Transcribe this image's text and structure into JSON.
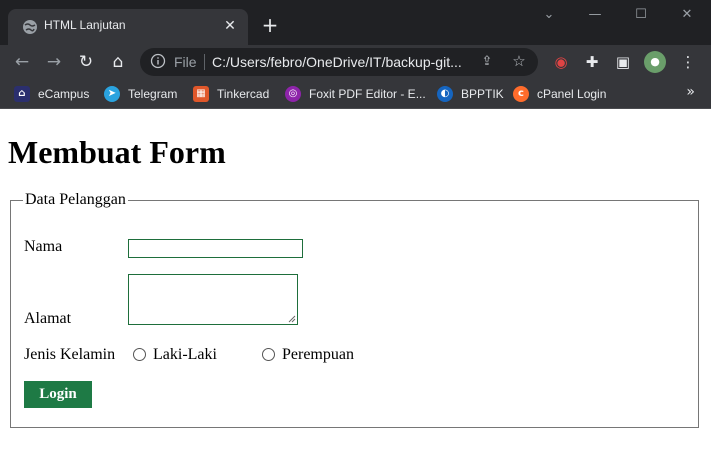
{
  "browser": {
    "tab_title": "HTML Lanjutan",
    "omnibox_scheme": "File",
    "url": "C:/Users/febro/OneDrive/IT/backup-git...",
    "bookmarks": [
      {
        "label": "eCampus"
      },
      {
        "label": "Telegram"
      },
      {
        "label": "Tinkercad"
      },
      {
        "label": "Foxit PDF Editor - E..."
      },
      {
        "label": "BPPTIK"
      },
      {
        "label": "cPanel Login"
      }
    ],
    "more_glyph": "»"
  },
  "page": {
    "heading": "Membuat Form",
    "fieldset_legend": "Data Pelanggan",
    "labels": {
      "nama": "Nama",
      "alamat": "Alamat",
      "jenis_kelamin": "Jenis Kelamin"
    },
    "inputs": {
      "nama_value": "",
      "alamat_value": ""
    },
    "radio_options": {
      "male": "Laki-Laki",
      "female": "Perempuan"
    },
    "login_button": "Login"
  },
  "colors": {
    "chrome_dark": "#202124",
    "chrome_toolbar": "#35363a",
    "input_border": "#1e6e3b",
    "button_bg": "#1e7a45"
  }
}
